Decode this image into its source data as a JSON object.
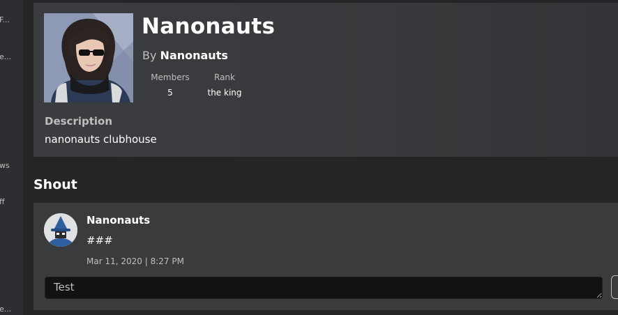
{
  "sidebar": {
    "items": [
      {
        "label": "F..."
      },
      {
        "label": "e..."
      },
      {
        "label": "ws"
      },
      {
        "label": "ff"
      },
      {
        "label": "e..."
      }
    ]
  },
  "group": {
    "name": "Nanonauts",
    "owner_prefix": "By",
    "owner_name": "Nanonauts",
    "members_label": "Members",
    "members_value": "5",
    "rank_label": "Rank",
    "rank_value": "the king",
    "description_title": "Description",
    "description_text": "nanonauts clubhouse"
  },
  "shout": {
    "title": "Shout",
    "poster_name": "Nanonauts",
    "body": "###",
    "date": "Mar 11, 2020 | 8:27 PM",
    "input_value": "Test"
  },
  "colors": {
    "page_background": "#232527",
    "card_background": "#393b3d",
    "input_background": "#121215",
    "secondary_text": "#bdbebe"
  }
}
